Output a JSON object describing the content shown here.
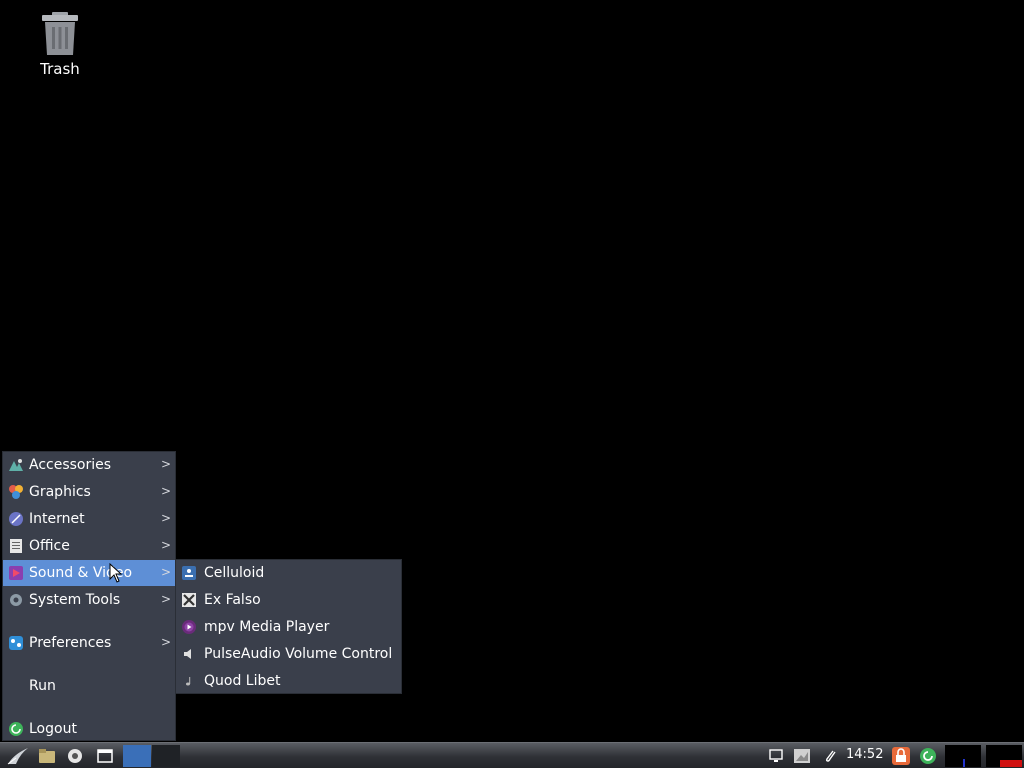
{
  "desktop": {
    "trash_label": "Trash"
  },
  "menu": {
    "items": [
      {
        "label": "Accessories",
        "icon": "accessories-icon"
      },
      {
        "label": "Graphics",
        "icon": "graphics-icon"
      },
      {
        "label": "Internet",
        "icon": "internet-icon"
      },
      {
        "label": "Office",
        "icon": "office-icon"
      },
      {
        "label": "Sound & Video",
        "icon": "sound-video-icon",
        "active": true
      },
      {
        "label": "System Tools",
        "icon": "system-tools-icon"
      },
      {
        "label": "Preferences",
        "icon": "preferences-icon"
      },
      {
        "label": "Run",
        "icon": ""
      },
      {
        "label": "Logout",
        "icon": "logout-icon"
      }
    ],
    "arrow_glyph": ">"
  },
  "submenu": {
    "items": [
      {
        "label": "Celluloid",
        "icon": "celluloid-icon"
      },
      {
        "label": "Ex Falso",
        "icon": "ex-falso-icon"
      },
      {
        "label": "mpv Media Player",
        "icon": "mpv-icon"
      },
      {
        "label": "PulseAudio Volume Control",
        "icon": "speaker-icon"
      },
      {
        "label": "Quod Libet",
        "icon": "quod-libet-icon"
      }
    ]
  },
  "taskbar": {
    "clock": "14:52"
  },
  "colors": {
    "menu_bg": "#3a3f4b",
    "active": "#5e8fd6",
    "desktop": "#000000"
  }
}
